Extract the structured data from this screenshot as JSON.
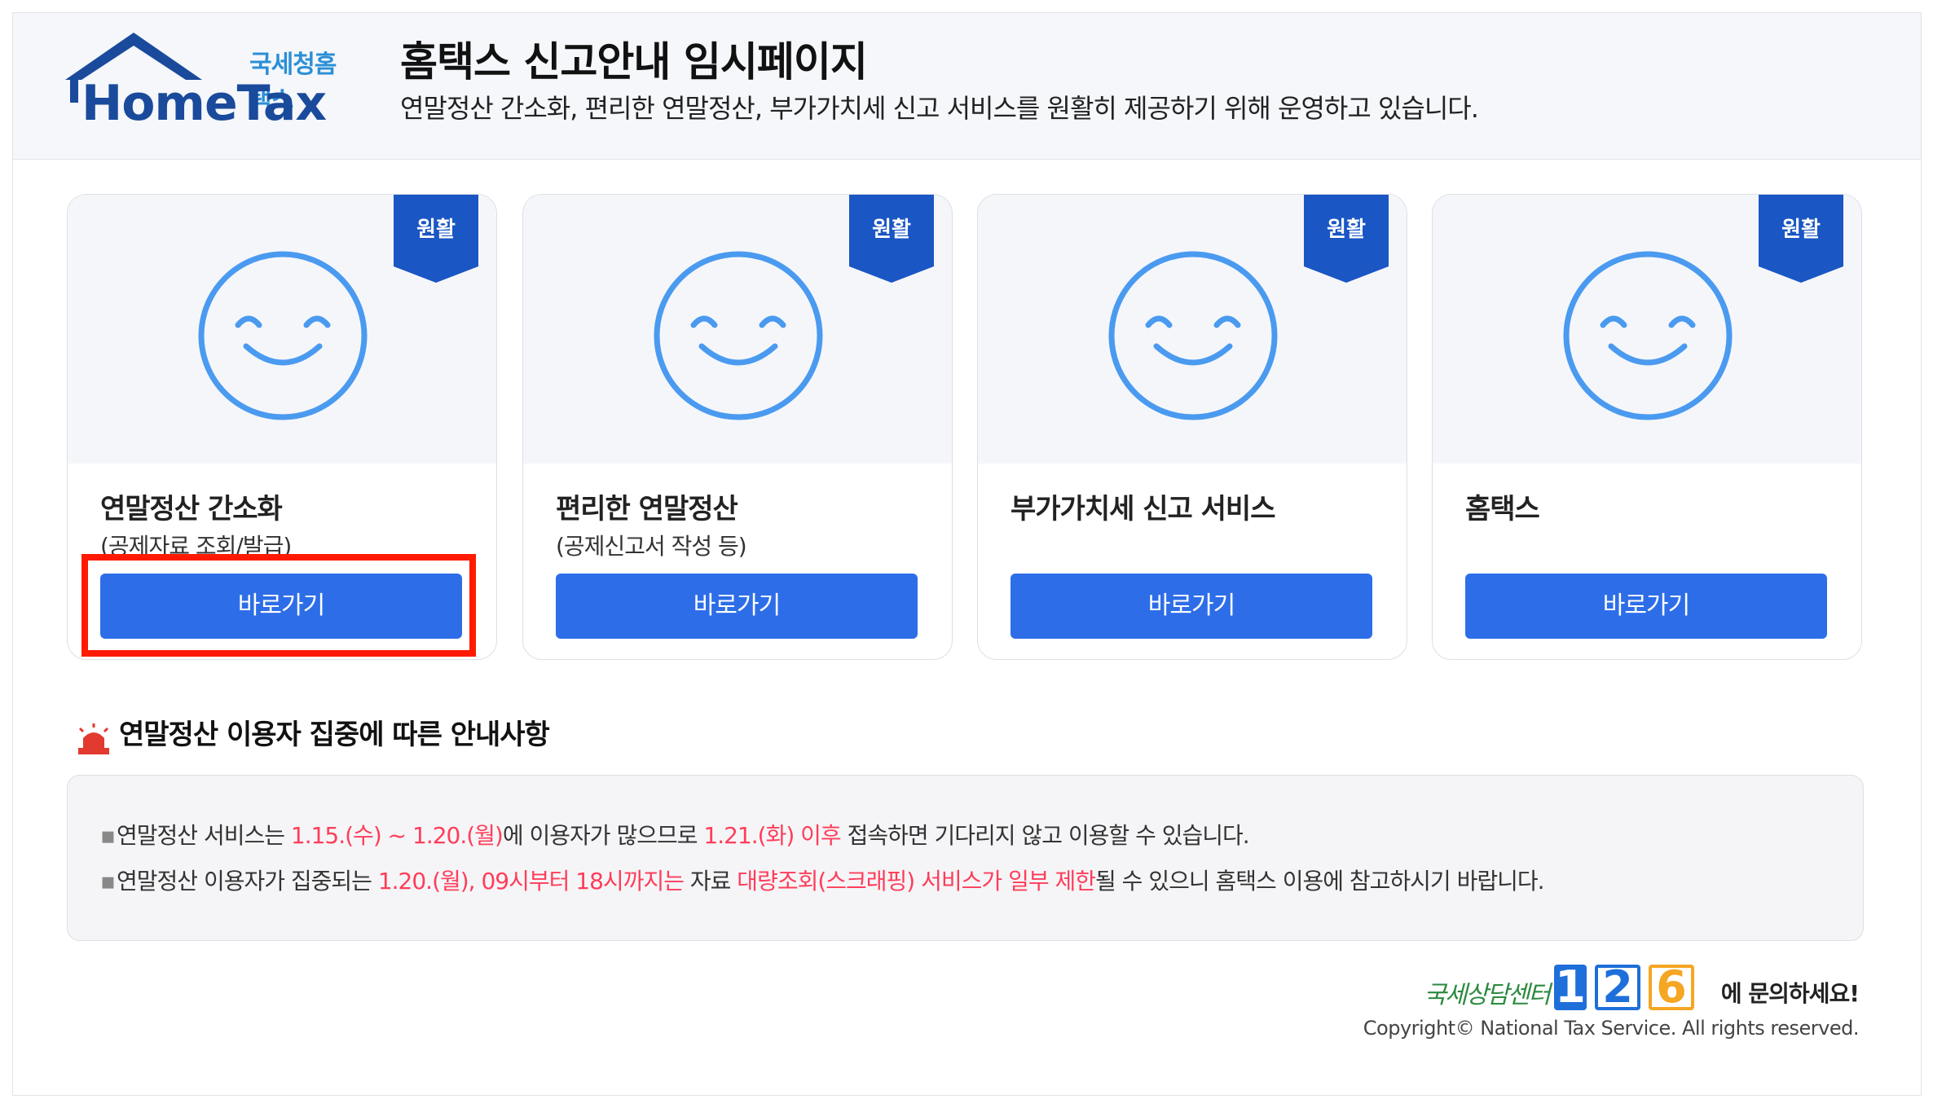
{
  "header": {
    "logo_kr": "국세청홈택스",
    "logo_en": "HomeTax",
    "title": "홈택스 신고안내 임시페이지",
    "subtitle": "연말정산 간소화, 편리한 연말정산, 부가가치세 신고 서비스를 원활히 제공하기 위해 운영하고 있습니다."
  },
  "cards": [
    {
      "status": "원활",
      "title": "연말정산 간소화",
      "sub": "(공제자료 조회/발급)",
      "button": "바로가기"
    },
    {
      "status": "원활",
      "title": "편리한 연말정산",
      "sub": "(공제신고서 작성 등)",
      "button": "바로가기"
    },
    {
      "status": "원활",
      "title": "부가가치세 신고 서비스",
      "sub": "",
      "button": "바로가기"
    },
    {
      "status": "원활",
      "title": "홈택스",
      "sub": "",
      "button": "바로가기"
    }
  ],
  "notice": {
    "title": "연말정산 이용자 집중에 따른 안내사항",
    "line1": {
      "p1": "연말정산 서비스는 ",
      "r1": "1.15.(수) ~ 1.20.(월)",
      "p2": "에 이용자가 많으므로 ",
      "r2": "1.21.(화) 이후",
      "p3": " 접속하면 기다리지 않고 이용할 수 있습니다."
    },
    "line2": {
      "p1": "연말정산 이용자가 집중되는 ",
      "r1": "1.20.(월), 09시부터 18시까지는",
      "p2": " 자료 ",
      "r2": "대량조회(스크래핑) 서비스가 일부 제한",
      "p3": "될 수 있으니 홈택스 이용에 참고하시기 바랍니다."
    }
  },
  "footer": {
    "call_center": "국세상담센터",
    "digit1": "1",
    "digit2": "2",
    "digit3": "6",
    "call_text": "에 문의하세요!",
    "copyright": "Copyright© National Tax Service. All rights reserved."
  },
  "colors": {
    "primary_button": "#2d6ee8",
    "ribbon": "#1a56c4",
    "smile": "#4a9af0",
    "highlight": "#ff3d5a",
    "annotation_box": "#ff1a00"
  }
}
